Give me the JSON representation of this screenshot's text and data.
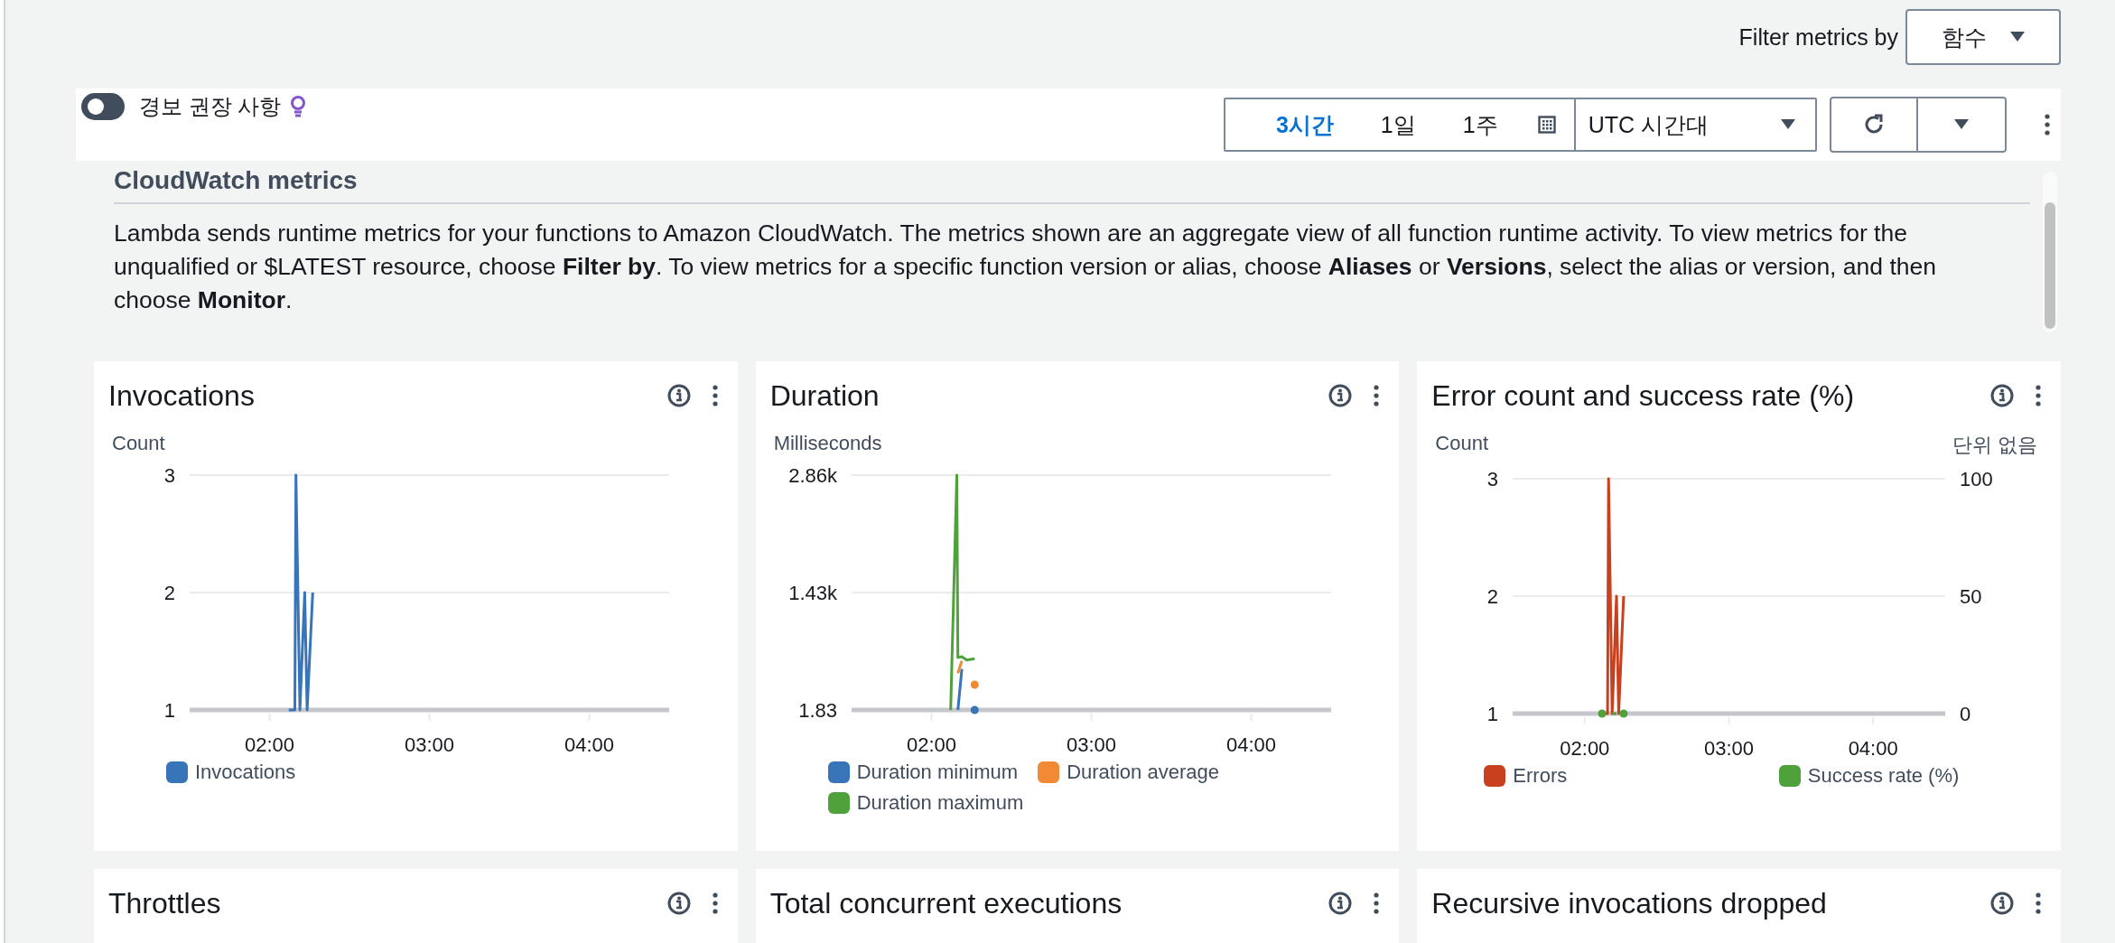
{
  "filter": {
    "label": "Filter metrics by",
    "value": "함수"
  },
  "toolbar": {
    "alarm_toggle": {
      "label": "경보 권장 사항",
      "on": false
    },
    "time_ranges": [
      {
        "label": "3시간",
        "selected": true
      },
      {
        "label": "1일",
        "selected": false
      },
      {
        "label": "1주",
        "selected": false
      }
    ],
    "timezone": "UTC 시간대"
  },
  "section": {
    "heading": "CloudWatch metrics",
    "description": "Lambda sends runtime metrics for your functions to Amazon CloudWatch. The metrics shown are an aggregate view of all function runtime activity. To view metrics for the unqualified or $LATEST resource, choose **Filter by**. To view metrics for a specific function version or alias, choose **Aliases** or **Versions**, select the alias or version, and then choose **Monitor**."
  },
  "cards": [
    {
      "title": "Invocations",
      "chart_data": {
        "type": "line",
        "ylabel": "Count",
        "x": [
          2.12,
          2.158,
          2.165,
          2.19,
          2.22,
          2.235,
          2.27
        ],
        "xlim": [
          1.5,
          4.5
        ],
        "xticks": [
          {
            "value": 2,
            "label": "02:00"
          },
          {
            "value": 3,
            "label": "03:00"
          },
          {
            "value": 4,
            "label": "04:00"
          }
        ],
        "ylim": [
          1,
          3
        ],
        "yticks": [
          1,
          2,
          3
        ],
        "series": [
          {
            "name": "Invocations",
            "color": "#3874b8",
            "values": [
              1,
              1,
              3,
              1,
              2,
              1,
              2
            ]
          }
        ]
      }
    },
    {
      "title": "Duration",
      "chart_data": {
        "type": "line",
        "ylabel": "Milliseconds",
        "x": [
          2.12,
          2.158,
          2.165,
          2.19,
          2.22,
          2.27
        ],
        "xlim": [
          1.5,
          4.5
        ],
        "xticks": [
          {
            "value": 2,
            "label": "02:00"
          },
          {
            "value": 3,
            "label": "03:00"
          },
          {
            "value": 4,
            "label": "04:00"
          }
        ],
        "ylim": [
          1.83,
          2860
        ],
        "yticks": [
          {
            "value": 1.83,
            "label": "1.83"
          },
          {
            "value": 1430,
            "label": "1.43k"
          },
          {
            "value": 2860,
            "label": "2.86k"
          }
        ],
        "series": [
          {
            "name": "Duration minimum",
            "color": "#3874b8",
            "values": [
              null,
              null,
              1.83,
              500,
              null,
              1.83
            ]
          },
          {
            "name": "Duration average",
            "color": "#f08a34",
            "values": [
              null,
              null,
              450,
              600,
              null,
              310
            ]
          },
          {
            "name": "Duration maximum",
            "color": "#4fa23b",
            "values": [
              1.83,
              2860,
              640,
              650,
              610,
              625
            ]
          }
        ]
      }
    },
    {
      "title": "Error count and success rate (%)",
      "chart_data": {
        "type": "line",
        "ylabel": "Count",
        "y2label": "단위 없음",
        "x": [
          2.12,
          2.158,
          2.165,
          2.19,
          2.22,
          2.235,
          2.27
        ],
        "xlim": [
          1.5,
          4.5
        ],
        "xticks": [
          {
            "value": 2,
            "label": "02:00"
          },
          {
            "value": 3,
            "label": "03:00"
          },
          {
            "value": 4,
            "label": "04:00"
          }
        ],
        "ylim": [
          1,
          3
        ],
        "yticks": [
          1,
          2,
          3
        ],
        "y2lim": [
          0,
          100
        ],
        "y2ticks": [
          0,
          50,
          100
        ],
        "series": [
          {
            "name": "Errors",
            "color": "#c9401f",
            "values": [
              1,
              1,
              3,
              1,
              2,
              1,
              2
            ]
          },
          {
            "name": "Success rate (%)",
            "color": "#4fa23b",
            "axis": "y2",
            "values": [
              0,
              null,
              null,
              0,
              0,
              null,
              0
            ]
          }
        ]
      }
    },
    {
      "title": "Throttles"
    },
    {
      "title": "Total concurrent executions"
    },
    {
      "title": "Recursive invocations dropped"
    }
  ]
}
